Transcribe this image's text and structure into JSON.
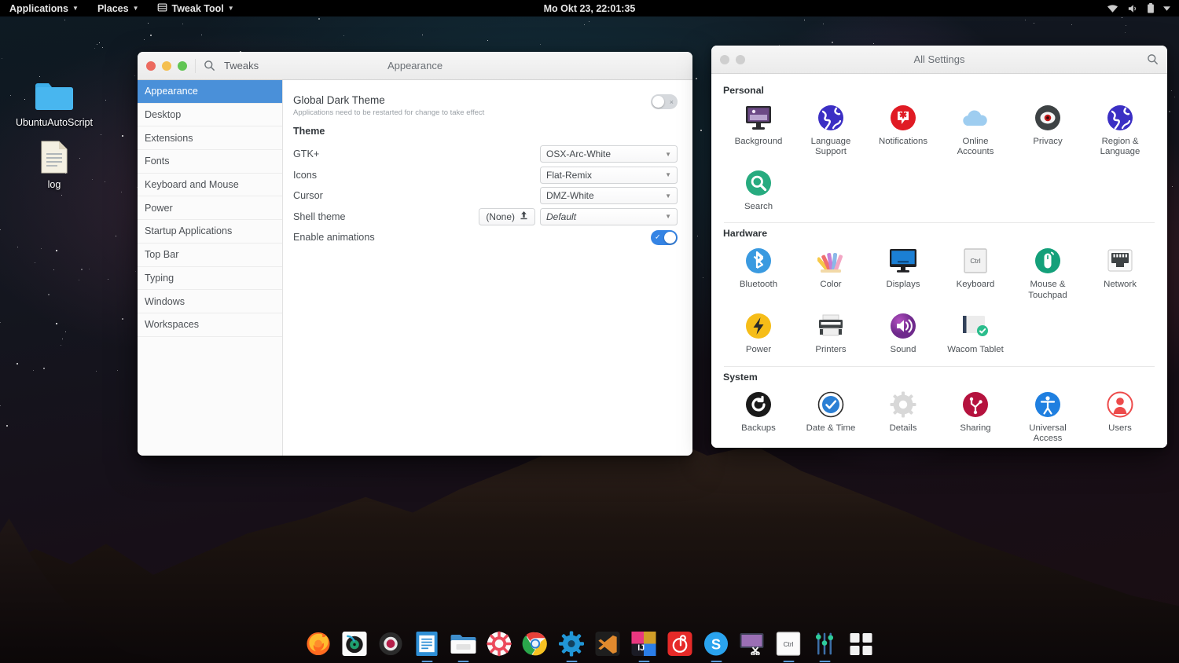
{
  "topbar": {
    "menus": [
      {
        "label": "Applications",
        "icon": "none",
        "caret": true
      },
      {
        "label": "Places",
        "icon": "none",
        "caret": true
      },
      {
        "label": "Tweak Tool",
        "icon": "window-icon",
        "caret": true
      }
    ],
    "clock": "Mo Okt 23, 22:01:35",
    "indicators": [
      "wifi-icon",
      "volume-icon",
      "battery-icon",
      "chevron-down-icon"
    ]
  },
  "desktop": {
    "icons": [
      {
        "label": "UbuntuAutoScript",
        "type": "folder"
      },
      {
        "label": "log",
        "type": "document"
      }
    ]
  },
  "tweaks": {
    "app_label": "Tweaks",
    "title": "Appearance",
    "search_icon": "search-icon",
    "sidebar": [
      {
        "label": "Appearance",
        "selected": true
      },
      {
        "label": "Desktop",
        "selected": false
      },
      {
        "label": "Extensions",
        "selected": false
      },
      {
        "label": "Fonts",
        "selected": false
      },
      {
        "label": "Keyboard and Mouse",
        "selected": false
      },
      {
        "label": "Power",
        "selected": false
      },
      {
        "label": "Startup Applications",
        "selected": false
      },
      {
        "label": "Top Bar",
        "selected": false
      },
      {
        "label": "Typing",
        "selected": false
      },
      {
        "label": "Windows",
        "selected": false
      },
      {
        "label": "Workspaces",
        "selected": false
      }
    ],
    "global_dark": {
      "title": "Global Dark Theme",
      "subtitle": "Applications need to be restarted for change to take effect",
      "state": "off",
      "mark": "×"
    },
    "theme_heading": "Theme",
    "rows": [
      {
        "label": "GTK+",
        "value": "OSX-Arc-White",
        "italic": false
      },
      {
        "label": "Icons",
        "value": "Flat-Remix",
        "italic": false
      },
      {
        "label": "Cursor",
        "value": "DMZ-White",
        "italic": false
      }
    ],
    "shell_theme": {
      "label": "Shell theme",
      "upload_label": "(None)",
      "upload_icon": "upload-icon",
      "value": "Default",
      "italic": true
    },
    "animations": {
      "label": "Enable animations",
      "state": "on",
      "mark": "✓"
    },
    "accent": "#4a90d9"
  },
  "settings": {
    "title": "All Settings",
    "search_icon": "search-icon",
    "sections": [
      {
        "name": "Personal",
        "items": [
          {
            "label": "Background",
            "icon": "monitor-picture-icon",
            "color": "#6c4a86"
          },
          {
            "label": "Language\nSupport",
            "icon": "globe-icon",
            "color": "#3b2fc4"
          },
          {
            "label": "Notifications",
            "icon": "notification-bubble-icon",
            "color": "#e01b24"
          },
          {
            "label": "Online\nAccounts",
            "icon": "cloud-icon",
            "color": "#9ecdf0"
          },
          {
            "label": "Privacy",
            "icon": "eye-icon",
            "color": "#3d4244"
          },
          {
            "label": "Region &\nLanguage",
            "icon": "globe-icon",
            "color": "#3b2fc4"
          },
          {
            "label": "Search",
            "icon": "search-magnifier-icon",
            "color": "#27ab7f"
          }
        ]
      },
      {
        "name": "Hardware",
        "items": [
          {
            "label": "Bluetooth",
            "icon": "bluetooth-icon",
            "color": "#3a9ae0"
          },
          {
            "label": "Color",
            "icon": "color-fan-icon",
            "color": "#e8a0b8"
          },
          {
            "label": "Displays",
            "icon": "display-icon",
            "color": "#1b7fd4"
          },
          {
            "label": "Keyboard",
            "icon": "keyboard-ctrl-icon",
            "color": "#f2f2f2"
          },
          {
            "label": "Mouse &\nTouchpad",
            "icon": "mouse-icon",
            "color": "#14a07a"
          },
          {
            "label": "Network",
            "icon": "network-port-icon",
            "color": "#3d4244"
          },
          {
            "label": "Power",
            "icon": "power-bolt-icon",
            "color": "#f6bd18"
          },
          {
            "label": "Printers",
            "icon": "printer-icon",
            "color": "#3d4244"
          },
          {
            "label": "Sound",
            "icon": "speaker-icon",
            "color": "#8b3a9e"
          },
          {
            "label": "Wacom Tablet",
            "icon": "tablet-pen-icon",
            "color": "#2bbd8c"
          }
        ]
      },
      {
        "name": "System",
        "items": [
          {
            "label": "Backups",
            "icon": "backup-loop-icon",
            "color": "#1a1a1a"
          },
          {
            "label": "Date & Time",
            "icon": "clock-icon",
            "color": "#2b7fd4"
          },
          {
            "label": "Details",
            "icon": "gear-icon",
            "color": "#d8d8d8"
          },
          {
            "label": "Sharing",
            "icon": "share-nodes-icon",
            "color": "#b5123e"
          },
          {
            "label": "Universal\nAccess",
            "icon": "accessibility-icon",
            "color": "#1f7fe0"
          },
          {
            "label": "Users",
            "icon": "user-icon",
            "color": "#ed4a4a"
          }
        ]
      }
    ]
  },
  "dock": {
    "items": [
      {
        "name": "firefox",
        "running": false
      },
      {
        "name": "rhythmbox",
        "running": false
      },
      {
        "name": "media-player",
        "running": false
      },
      {
        "name": "libreoffice-writer",
        "running": true
      },
      {
        "name": "files",
        "running": true
      },
      {
        "name": "help",
        "running": false
      },
      {
        "name": "chrome",
        "running": false
      },
      {
        "name": "settings",
        "running": true
      },
      {
        "name": "vscode",
        "running": false
      },
      {
        "name": "intellij-idea",
        "running": true
      },
      {
        "name": "netease-music",
        "running": false
      },
      {
        "name": "skype",
        "running": true
      },
      {
        "name": "screenshot",
        "running": false
      },
      {
        "name": "keyboard-ctrl",
        "running": true
      },
      {
        "name": "audio-mixer",
        "running": true
      },
      {
        "name": "app-grid",
        "running": false
      }
    ]
  }
}
